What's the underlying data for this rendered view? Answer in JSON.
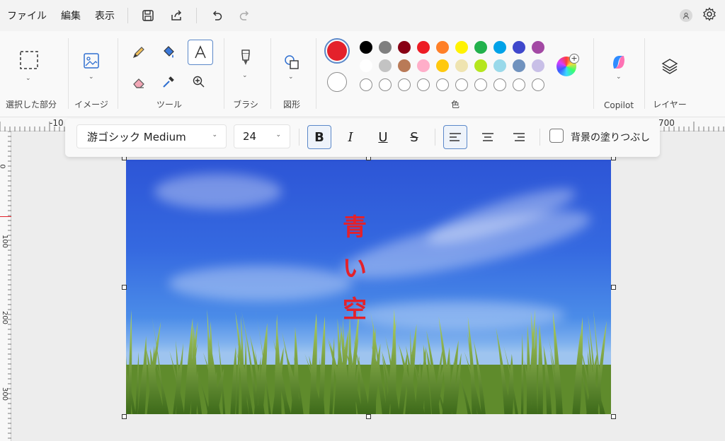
{
  "menubar": {
    "items": [
      "ファイル",
      "編集",
      "表示"
    ]
  },
  "ribbon": {
    "groups": {
      "selection": "選択した部分",
      "image": "イメージ",
      "tools": "ツール",
      "brush": "ブラシ",
      "shapes": "図形",
      "colors": "色",
      "copilot": "Copilot",
      "layers": "レイヤー"
    },
    "primary_color": "#e4212b",
    "secondary_color": "#ffffff",
    "palette_row1": [
      "#000000",
      "#7f7f7f",
      "#880015",
      "#ed1c24",
      "#ff7f27",
      "#fff200",
      "#22b14c",
      "#00a2e8",
      "#3f48cc",
      "#a349a4"
    ],
    "palette_row2": [
      "#ffffff",
      "#c3c3c3",
      "#b97a57",
      "#ffaec9",
      "#ffc90e",
      "#efe4b0",
      "#b5e61d",
      "#99d9ea",
      "#7092be",
      "#c8bfe7"
    ]
  },
  "ruler": {
    "h_labels": [
      "-10",
      "700"
    ],
    "v_labels": [
      "0",
      "100",
      "200",
      "300"
    ]
  },
  "textbar": {
    "font": "游ゴシック Medium",
    "size": "24",
    "bold": "B",
    "italic": "I",
    "underline": "U",
    "strike": "S",
    "fill_label": "背景の塗りつぶし"
  },
  "canvas": {
    "text_chars": [
      "青",
      "い",
      "空"
    ]
  }
}
